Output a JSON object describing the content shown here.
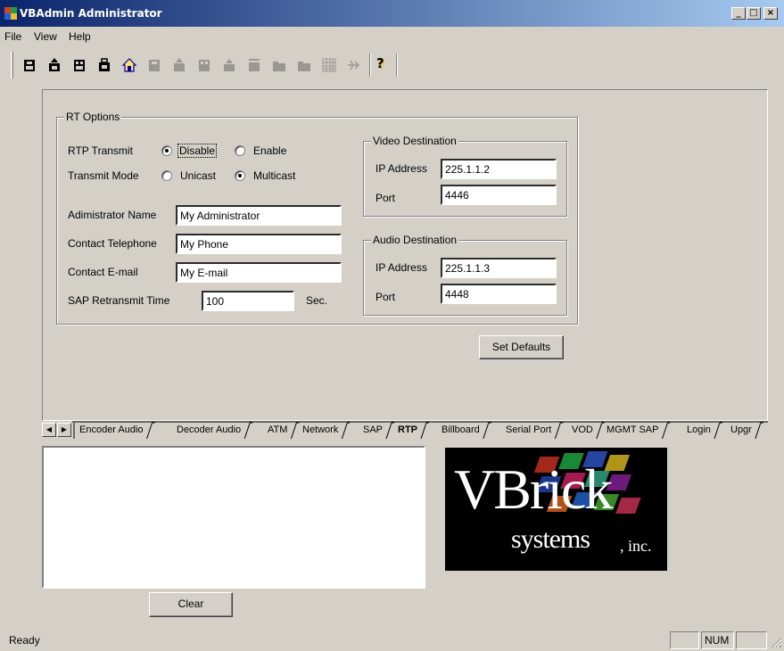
{
  "window": {
    "title": "VBAdmin Administrator",
    "minimize_glyph": "_",
    "maximize_glyph": "□",
    "close_glyph": "×"
  },
  "menu": {
    "file": "File",
    "view": "View",
    "help": "Help"
  },
  "toolbar": {
    "icons": [
      "disk-icon",
      "disk-upload-icon",
      "disk-dual-icon",
      "disk-lock-icon",
      "home-icon",
      "disk-disabled-icon",
      "disk-upload-disabled-icon",
      "disk-dual-disabled-icon",
      "upload-disabled-icon",
      "disk-bar-disabled-icon",
      "folder-disabled-icon",
      "folder2-disabled-icon",
      "grid-disabled-icon",
      "arrow-disabled-icon",
      "help-icon"
    ],
    "help_glyph": "?"
  },
  "rt_options": {
    "legend": "RT Options",
    "rtp_transmit_label": "RTP Transmit",
    "disable_label": "Disable",
    "enable_label": "Enable",
    "rtp_transmit_value": "Disable",
    "transmit_mode_label": "Transmit Mode",
    "unicast_label": "Unicast",
    "multicast_label": "Multicast",
    "transmit_mode_value": "Multicast",
    "admin_name_label": "Adimistrator Name",
    "admin_name_value": "My Administrator",
    "contact_phone_label": "Contact Telephone",
    "contact_phone_value": "My Phone",
    "contact_email_label": "Contact E-mail",
    "contact_email_value": "My E-mail",
    "sap_retransmit_label": "SAP Retransmit Time",
    "sap_retransmit_value": "100",
    "sap_unit": "Sec."
  },
  "video_destination": {
    "legend": "Video Destination",
    "ip_label": "IP Address",
    "ip_value": "225.1.1.2",
    "port_label": "Port",
    "port_value": "4446"
  },
  "audio_destination": {
    "legend": "Audio Destination",
    "ip_label": "IP Address",
    "ip_value": "225.1.1.3",
    "port_label": "Port",
    "port_value": "4448"
  },
  "set_defaults_label": "Set Defaults",
  "tabs": [
    "Encoder Audio",
    "Decoder Audio",
    "ATM",
    "Network",
    "SAP",
    "RTP",
    "Billboard",
    "Serial Port",
    "VOD",
    "MGMT SAP",
    "Login",
    "Upgr"
  ],
  "active_tab": "RTP",
  "tab_scroll": {
    "left": "◀",
    "right": "▶"
  },
  "logo": {
    "brand": "VBrick",
    "sub": "systems",
    "suffix": ", inc."
  },
  "clear_label": "Clear",
  "status": {
    "text": "Ready",
    "num": "NUM"
  },
  "colors": {
    "titlebar_start": "#0a246a",
    "titlebar_end": "#a6caf0",
    "face": "#d4d0c8"
  }
}
